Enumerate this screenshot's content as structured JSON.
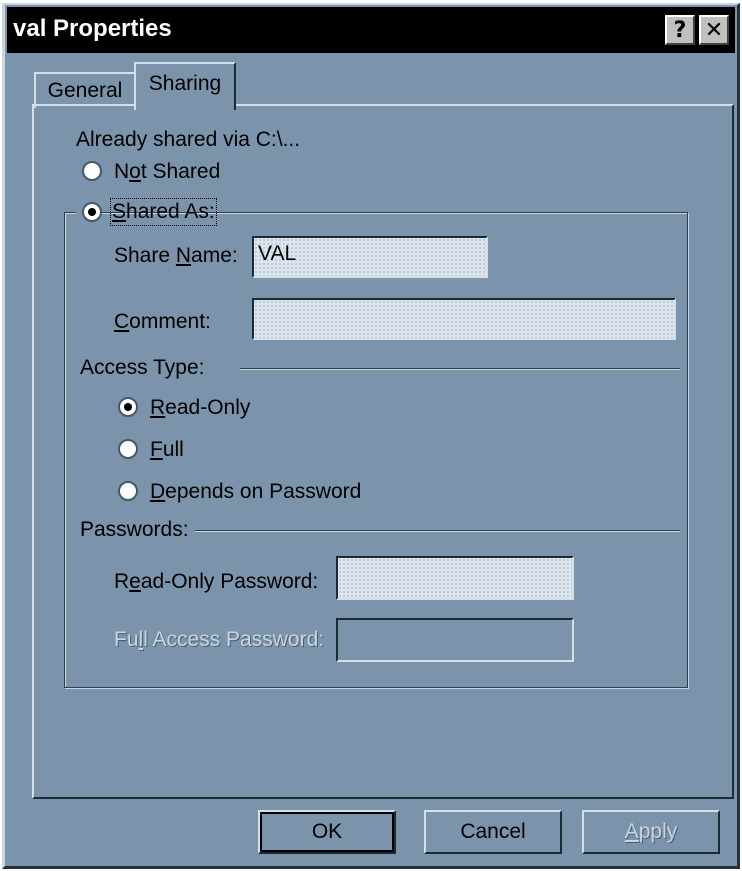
{
  "window": {
    "title": "val Properties",
    "help_glyph": "?",
    "close_glyph": "✕"
  },
  "tabs": [
    {
      "label": "General",
      "selected": false
    },
    {
      "label": "Sharing",
      "selected": true
    }
  ],
  "sharing": {
    "already_shared": "Already shared via C:\\...",
    "not_shared": {
      "pre": "N",
      "key": "o",
      "post": "t Shared",
      "checked": false
    },
    "shared_as": {
      "pre": "",
      "key": "S",
      "post": "hared As:",
      "checked": true
    },
    "share_name": {
      "pre": "Share ",
      "key": "N",
      "post": "ame:",
      "value": "VAL"
    },
    "comment": {
      "pre": "",
      "key": "C",
      "post": "omment:",
      "value": ""
    },
    "access_type_label": "Access Type:",
    "access": [
      {
        "pre": "",
        "key": "R",
        "post": "ead-Only",
        "checked": true
      },
      {
        "pre": "",
        "key": "F",
        "post": "ull",
        "checked": false
      },
      {
        "pre": "",
        "key": "D",
        "post": "epends on Password",
        "checked": false
      }
    ],
    "passwords_label": "Passwords:",
    "read_only_password": {
      "pre": "R",
      "key": "e",
      "post": "ad-Only Password:",
      "value": ""
    },
    "full_access_password": {
      "pre": "Fu",
      "key": "l",
      "post": "l Access Password:",
      "value": "",
      "disabled": true
    }
  },
  "buttons": {
    "ok": "OK",
    "cancel": "Cancel",
    "apply": {
      "key": "A",
      "post": "pply",
      "disabled": true
    }
  },
  "colors": {
    "face": "#7b94ab",
    "titlebar": "#000000",
    "highlight": "#d4dfe8",
    "shadow": "#1d2a35"
  }
}
